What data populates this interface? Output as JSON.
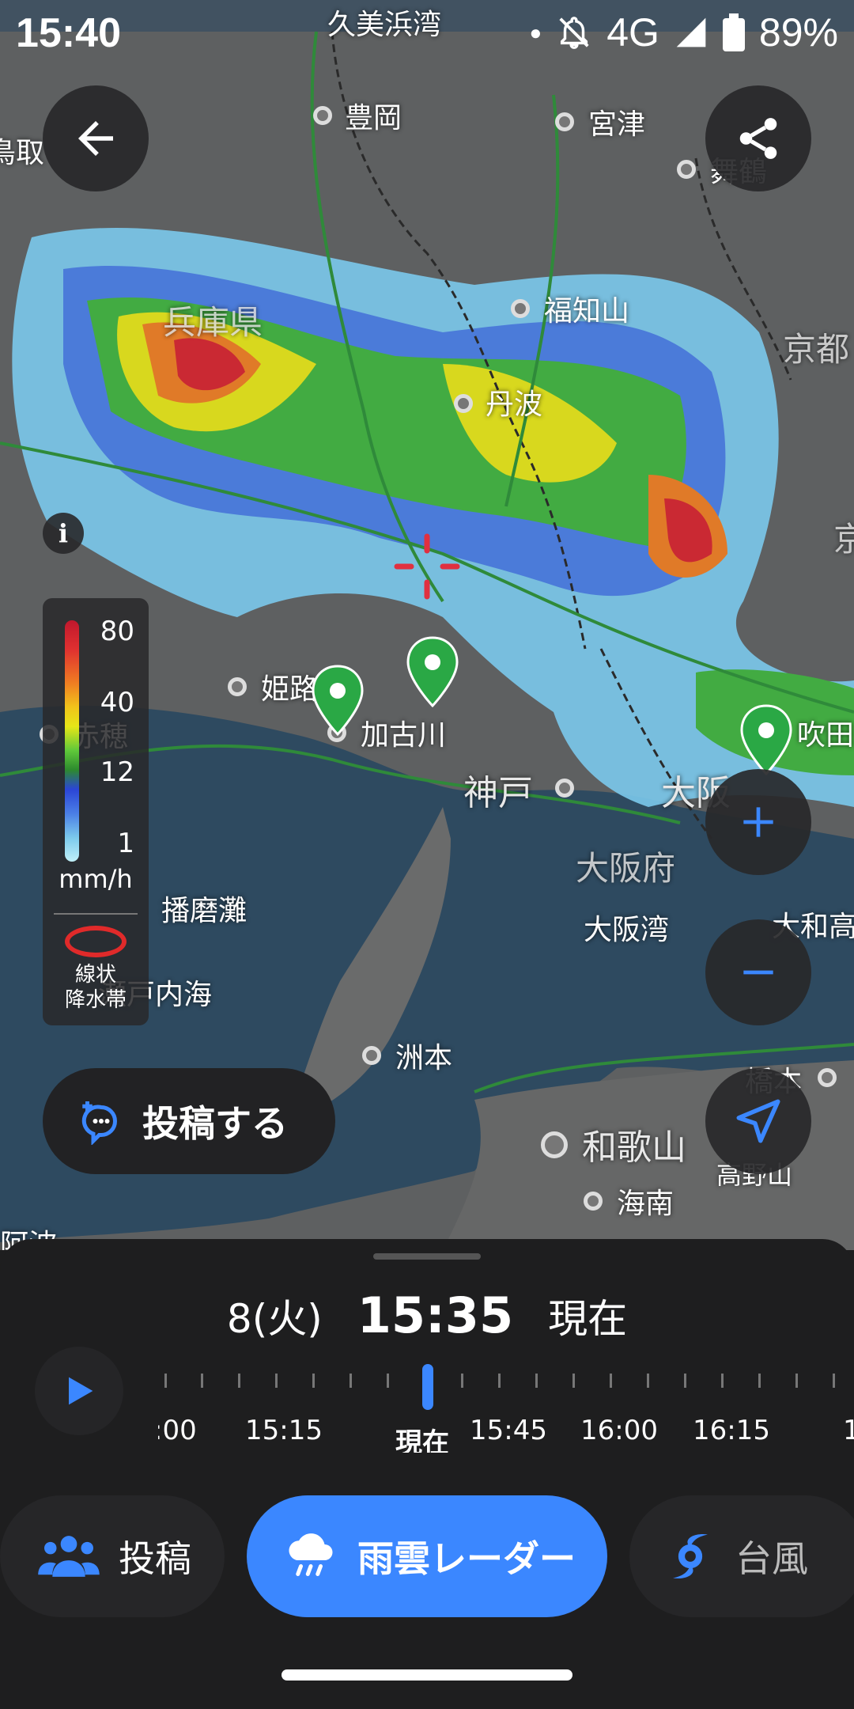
{
  "status_bar": {
    "time": "15:40",
    "network": "4G",
    "battery": "89%"
  },
  "map": {
    "places": {
      "kumihama": "久美浜湾",
      "toyooka": "豊岡",
      "miyazu": "宮津",
      "maizuru": "舞鶴",
      "tottori": "鳥取",
      "hyogo": "兵庫県",
      "fukuchiyama": "福知山",
      "kyoto": "京都",
      "tamba": "丹波",
      "kyoto2": "京",
      "himeji": "姫路",
      "ako": "赤穂",
      "kakogawa": "加古川",
      "suita": "吹田",
      "kobe": "神戸",
      "osaka": "大阪",
      "osakafu": "大阪府",
      "harimanada": "播磨灘",
      "setonaikai": "瀬戸内海",
      "osakawan": "大阪湾",
      "yamatotaka": "大和高",
      "sumoto": "洲本",
      "hashimoto": "橋本",
      "wakayama": "和歌山",
      "kaiyama": "高野山",
      "kainan": "海南",
      "awa": "阿波"
    }
  },
  "legend": {
    "values": [
      "80",
      "40",
      "12",
      "1"
    ],
    "unit": "mm/h",
    "band_line1": "線状",
    "band_line2": "降水帯",
    "colors": [
      "#c0182d",
      "#ef7d22",
      "#e6e617",
      "#2d8a2e",
      "#2b45d6",
      "#7bc9ec"
    ]
  },
  "info_label": "i",
  "post_button": {
    "label": "投稿する"
  },
  "time_panel": {
    "date": "8(火)",
    "time": "15:35",
    "status": "現在",
    "timeline_labels": [
      ":00",
      "15:15",
      "現在",
      "15:45",
      "16:00",
      "16:15",
      "1"
    ]
  },
  "tabs": [
    {
      "label": "投稿",
      "icon": "people-icon"
    },
    {
      "label": "雨雲レーダー",
      "icon": "rain-cloud-icon"
    },
    {
      "label": "台風",
      "icon": "typhoon-icon"
    }
  ],
  "accent": "#3b87ff"
}
